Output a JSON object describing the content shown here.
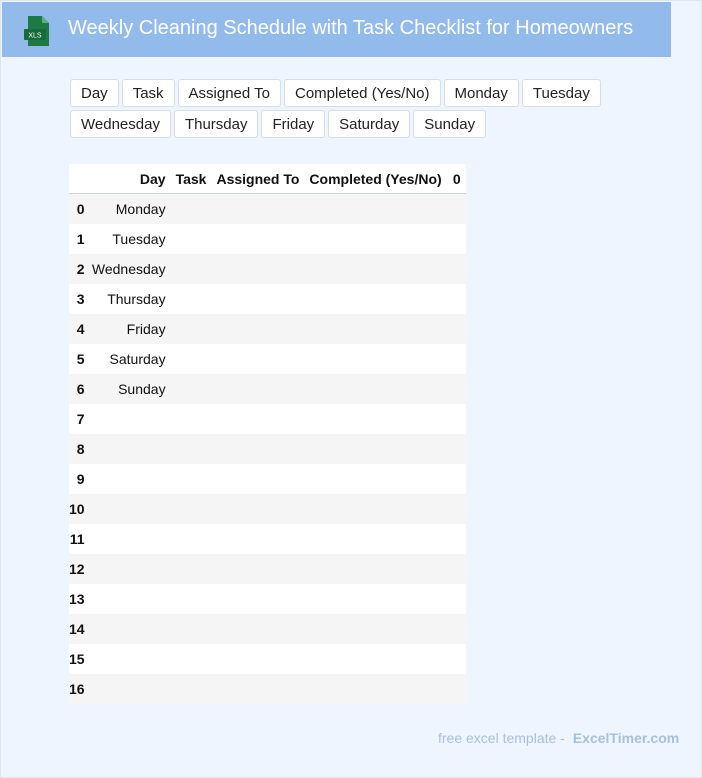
{
  "header": {
    "icon_label": "XLS",
    "title": "Weekly Cleaning Schedule with Task Checklist for Homeowners"
  },
  "chips": [
    "Day",
    "Task",
    "Assigned To",
    "Completed (Yes/No)",
    "Monday",
    "Tuesday",
    "Wednesday",
    "Thursday",
    "Friday",
    "Saturday",
    "Sunday"
  ],
  "table": {
    "columns": [
      "",
      "Day",
      "Task",
      "Assigned To",
      "Completed (Yes/No)",
      "0"
    ],
    "rows": [
      {
        "index": "0",
        "day": "Monday"
      },
      {
        "index": "1",
        "day": "Tuesday"
      },
      {
        "index": "2",
        "day": "Wednesday"
      },
      {
        "index": "3",
        "day": "Thursday"
      },
      {
        "index": "4",
        "day": "Friday"
      },
      {
        "index": "5",
        "day": "Saturday"
      },
      {
        "index": "6",
        "day": "Sunday"
      },
      {
        "index": "7",
        "day": ""
      },
      {
        "index": "8",
        "day": ""
      },
      {
        "index": "9",
        "day": ""
      },
      {
        "index": "10",
        "day": ""
      },
      {
        "index": "11",
        "day": ""
      },
      {
        "index": "12",
        "day": ""
      },
      {
        "index": "13",
        "day": ""
      },
      {
        "index": "14",
        "day": ""
      },
      {
        "index": "15",
        "day": ""
      },
      {
        "index": "16",
        "day": ""
      }
    ]
  },
  "footer": {
    "text": "free excel template -",
    "brand": "ExcelTimer.com"
  },
  "colors": {
    "header_bg": "#92bbeb",
    "page_bg": "#eef5fe",
    "icon_green": "#1e7a45",
    "footer_text": "#a7c0de"
  }
}
